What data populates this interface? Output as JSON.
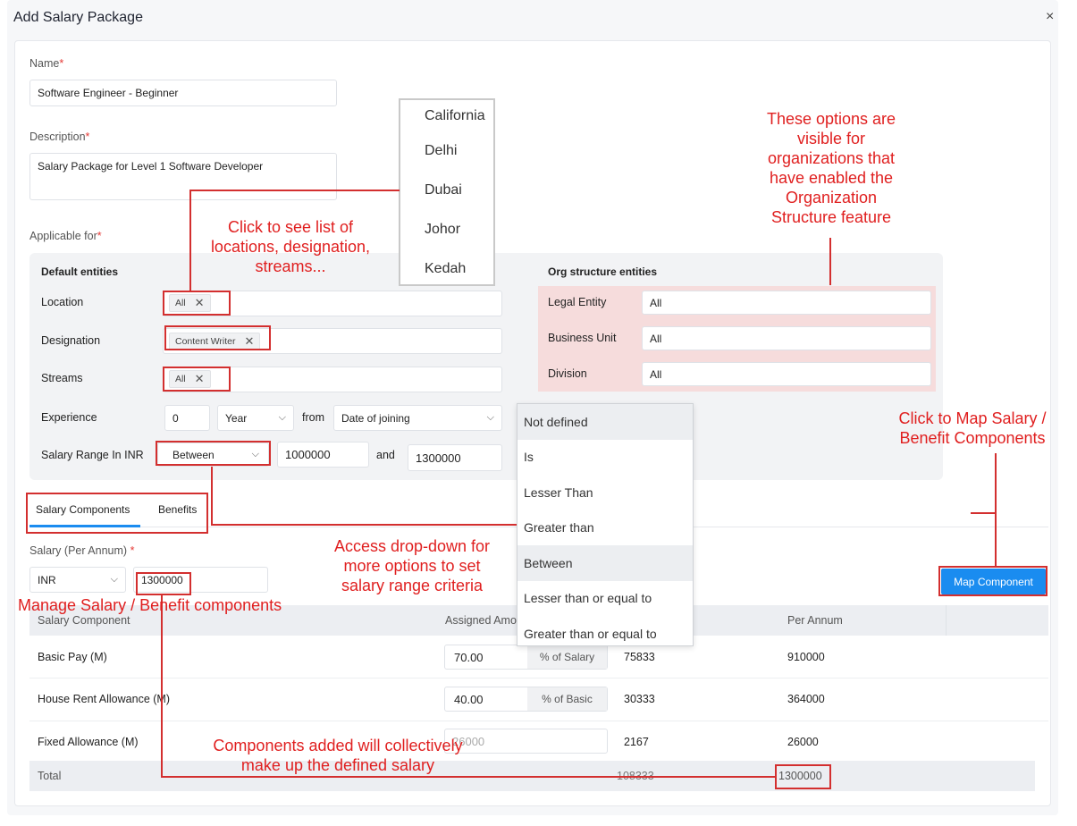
{
  "modal": {
    "title": "Add Salary Package",
    "close_label": "×"
  },
  "name": {
    "label": "Name",
    "value": "Software Engineer - Beginner"
  },
  "description": {
    "label": "Description",
    "value": "Salary Package for Level 1 Software Developer"
  },
  "applicable": {
    "label": "Applicable for",
    "default_header": "Default entities",
    "org_header": "Org structure entities",
    "location": {
      "label": "Location",
      "tag": "All"
    },
    "designation": {
      "label": "Designation",
      "tag": "Content Writer"
    },
    "streams": {
      "label": "Streams",
      "tag": "All"
    },
    "experience": {
      "label": "Experience",
      "value": "0",
      "unit": "Year",
      "from_label": "from",
      "from_value": "Date of joining"
    },
    "salary_range": {
      "label": "Salary Range In INR",
      "operator": "Between",
      "min": "1000000",
      "and_label": "and",
      "max": "1300000"
    },
    "legal_entity": {
      "label": "Legal Entity",
      "value": "All"
    },
    "business_unit": {
      "label": "Business Unit",
      "value": "All"
    },
    "division": {
      "label": "Division",
      "value": "All"
    }
  },
  "location_dropdown": [
    "California",
    "Delhi",
    "Dubai",
    "Johor",
    "Kedah"
  ],
  "range_dropdown": [
    "Not defined",
    "Is",
    "Lesser Than",
    "Greater than",
    "Between",
    "Lesser than or equal to",
    "Greater than or equal to"
  ],
  "tabs": [
    "Salary Components",
    "Benefits"
  ],
  "salary": {
    "label": "Salary (Per Annum)",
    "currency": "INR",
    "amount": "1300000"
  },
  "map_button": "Map Component",
  "table": {
    "headers": [
      "Salary Component",
      "Assigned Amo",
      "Per Annum"
    ],
    "rows": [
      {
        "name": "Basic Pay (M)",
        "amount": "70.00",
        "basis": "% of Salary",
        "monthly": "75833",
        "annual": "910000"
      },
      {
        "name": "House Rent Allowance (M)",
        "amount": "40.00",
        "basis": "% of Basic",
        "monthly": "30333",
        "annual": "364000"
      },
      {
        "name": "Fixed Allowance (M)",
        "amount": "26000",
        "basis": "",
        "monthly": "2167",
        "annual": "26000"
      }
    ],
    "total": {
      "label": "Total",
      "monthly": "108333",
      "annual": "1300000"
    }
  },
  "annotations": {
    "list": "Click to see list of locations, designation, streams...",
    "list_lines": [
      "Click to see list of",
      "locations, designation,",
      "streams..."
    ],
    "org": [
      "These options are",
      "visible for",
      "organizations that",
      "have enabled the",
      "Organization",
      "Structure feature"
    ],
    "map": [
      "Click to Map Salary /",
      "Benefit Components"
    ],
    "range": [
      "Access drop-down for",
      "more options to set",
      "salary range criteria"
    ],
    "manage": "Manage Salary / Benefit components",
    "components": [
      "Components added will collectively",
      "make up the defined salary"
    ]
  },
  "colors": {
    "accent": "#1a8cf0",
    "annotation": "#e01f1f",
    "org_highlight": "#f6dcdc"
  }
}
